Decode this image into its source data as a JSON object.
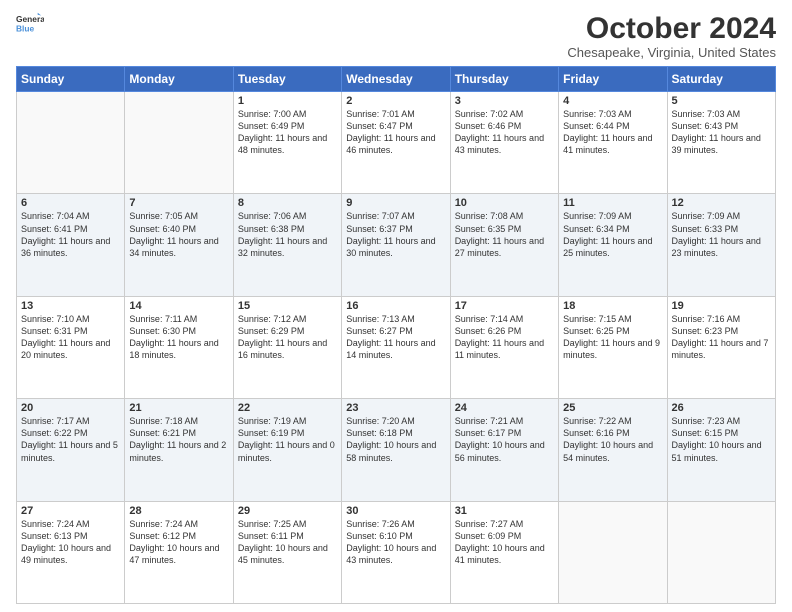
{
  "header": {
    "logo_line1": "General",
    "logo_line2": "Blue",
    "main_title": "October 2024",
    "subtitle": "Chesapeake, Virginia, United States"
  },
  "weekdays": [
    "Sunday",
    "Monday",
    "Tuesday",
    "Wednesday",
    "Thursday",
    "Friday",
    "Saturday"
  ],
  "weeks": [
    [
      {
        "day": "",
        "info": ""
      },
      {
        "day": "",
        "info": ""
      },
      {
        "day": "1",
        "info": "Sunrise: 7:00 AM\nSunset: 6:49 PM\nDaylight: 11 hours and 48 minutes."
      },
      {
        "day": "2",
        "info": "Sunrise: 7:01 AM\nSunset: 6:47 PM\nDaylight: 11 hours and 46 minutes."
      },
      {
        "day": "3",
        "info": "Sunrise: 7:02 AM\nSunset: 6:46 PM\nDaylight: 11 hours and 43 minutes."
      },
      {
        "day": "4",
        "info": "Sunrise: 7:03 AM\nSunset: 6:44 PM\nDaylight: 11 hours and 41 minutes."
      },
      {
        "day": "5",
        "info": "Sunrise: 7:03 AM\nSunset: 6:43 PM\nDaylight: 11 hours and 39 minutes."
      }
    ],
    [
      {
        "day": "6",
        "info": "Sunrise: 7:04 AM\nSunset: 6:41 PM\nDaylight: 11 hours and 36 minutes."
      },
      {
        "day": "7",
        "info": "Sunrise: 7:05 AM\nSunset: 6:40 PM\nDaylight: 11 hours and 34 minutes."
      },
      {
        "day": "8",
        "info": "Sunrise: 7:06 AM\nSunset: 6:38 PM\nDaylight: 11 hours and 32 minutes."
      },
      {
        "day": "9",
        "info": "Sunrise: 7:07 AM\nSunset: 6:37 PM\nDaylight: 11 hours and 30 minutes."
      },
      {
        "day": "10",
        "info": "Sunrise: 7:08 AM\nSunset: 6:35 PM\nDaylight: 11 hours and 27 minutes."
      },
      {
        "day": "11",
        "info": "Sunrise: 7:09 AM\nSunset: 6:34 PM\nDaylight: 11 hours and 25 minutes."
      },
      {
        "day": "12",
        "info": "Sunrise: 7:09 AM\nSunset: 6:33 PM\nDaylight: 11 hours and 23 minutes."
      }
    ],
    [
      {
        "day": "13",
        "info": "Sunrise: 7:10 AM\nSunset: 6:31 PM\nDaylight: 11 hours and 20 minutes."
      },
      {
        "day": "14",
        "info": "Sunrise: 7:11 AM\nSunset: 6:30 PM\nDaylight: 11 hours and 18 minutes."
      },
      {
        "day": "15",
        "info": "Sunrise: 7:12 AM\nSunset: 6:29 PM\nDaylight: 11 hours and 16 minutes."
      },
      {
        "day": "16",
        "info": "Sunrise: 7:13 AM\nSunset: 6:27 PM\nDaylight: 11 hours and 14 minutes."
      },
      {
        "day": "17",
        "info": "Sunrise: 7:14 AM\nSunset: 6:26 PM\nDaylight: 11 hours and 11 minutes."
      },
      {
        "day": "18",
        "info": "Sunrise: 7:15 AM\nSunset: 6:25 PM\nDaylight: 11 hours and 9 minutes."
      },
      {
        "day": "19",
        "info": "Sunrise: 7:16 AM\nSunset: 6:23 PM\nDaylight: 11 hours and 7 minutes."
      }
    ],
    [
      {
        "day": "20",
        "info": "Sunrise: 7:17 AM\nSunset: 6:22 PM\nDaylight: 11 hours and 5 minutes."
      },
      {
        "day": "21",
        "info": "Sunrise: 7:18 AM\nSunset: 6:21 PM\nDaylight: 11 hours and 2 minutes."
      },
      {
        "day": "22",
        "info": "Sunrise: 7:19 AM\nSunset: 6:19 PM\nDaylight: 11 hours and 0 minutes."
      },
      {
        "day": "23",
        "info": "Sunrise: 7:20 AM\nSunset: 6:18 PM\nDaylight: 10 hours and 58 minutes."
      },
      {
        "day": "24",
        "info": "Sunrise: 7:21 AM\nSunset: 6:17 PM\nDaylight: 10 hours and 56 minutes."
      },
      {
        "day": "25",
        "info": "Sunrise: 7:22 AM\nSunset: 6:16 PM\nDaylight: 10 hours and 54 minutes."
      },
      {
        "day": "26",
        "info": "Sunrise: 7:23 AM\nSunset: 6:15 PM\nDaylight: 10 hours and 51 minutes."
      }
    ],
    [
      {
        "day": "27",
        "info": "Sunrise: 7:24 AM\nSunset: 6:13 PM\nDaylight: 10 hours and 49 minutes."
      },
      {
        "day": "28",
        "info": "Sunrise: 7:24 AM\nSunset: 6:12 PM\nDaylight: 10 hours and 47 minutes."
      },
      {
        "day": "29",
        "info": "Sunrise: 7:25 AM\nSunset: 6:11 PM\nDaylight: 10 hours and 45 minutes."
      },
      {
        "day": "30",
        "info": "Sunrise: 7:26 AM\nSunset: 6:10 PM\nDaylight: 10 hours and 43 minutes."
      },
      {
        "day": "31",
        "info": "Sunrise: 7:27 AM\nSunset: 6:09 PM\nDaylight: 10 hours and 41 minutes."
      },
      {
        "day": "",
        "info": ""
      },
      {
        "day": "",
        "info": ""
      }
    ]
  ]
}
